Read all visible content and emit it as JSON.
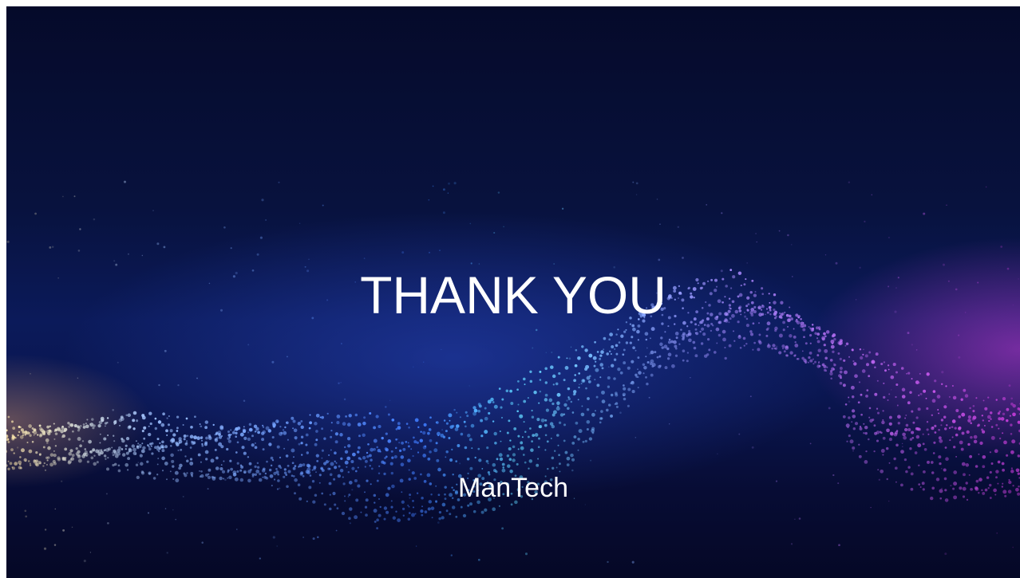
{
  "slide": {
    "title": "THANK YOU",
    "subtitle": "ManTech"
  },
  "colors": {
    "background_dark": "#050a2a",
    "background_mid": "#0b1a5a",
    "accent_magenta": "#cc3cdc",
    "accent_blue": "#3f7cff",
    "accent_cyan": "#5fd6ff",
    "accent_warm": "#ffe7a8"
  }
}
